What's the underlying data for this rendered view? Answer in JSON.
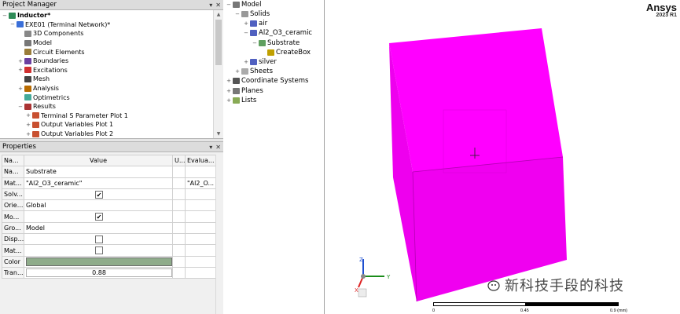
{
  "project_manager": {
    "title": "Project Manager",
    "tree": [
      {
        "label": "Inductor*",
        "level": 0,
        "expander": "−",
        "icon": "project-icon",
        "bold": true
      },
      {
        "label": "EXE01 (Terminal Network)*",
        "level": 1,
        "expander": "−",
        "icon": "design-icon"
      },
      {
        "label": "3D Components",
        "level": 2,
        "expander": "",
        "icon": "components-icon"
      },
      {
        "label": "Model",
        "level": 2,
        "expander": "",
        "icon": "model-icon"
      },
      {
        "label": "Circuit Elements",
        "level": 2,
        "expander": "",
        "icon": "circuit-icon"
      },
      {
        "label": "Boundaries",
        "level": 2,
        "expander": "+",
        "icon": "boundaries-icon"
      },
      {
        "label": "Excitations",
        "level": 2,
        "expander": "+",
        "icon": "excitations-icon"
      },
      {
        "label": "Mesh",
        "level": 2,
        "expander": "",
        "icon": "mesh-icon"
      },
      {
        "label": "Analysis",
        "level": 2,
        "expander": "+",
        "icon": "analysis-icon"
      },
      {
        "label": "Optimetrics",
        "level": 2,
        "expander": "",
        "icon": "optimetrics-icon"
      },
      {
        "label": "Results",
        "level": 2,
        "expander": "−",
        "icon": "results-icon"
      },
      {
        "label": "Terminal S Parameter Plot 1",
        "level": 3,
        "expander": "+",
        "icon": "plot-icon"
      },
      {
        "label": "Output Variables Plot 1",
        "level": 3,
        "expander": "+",
        "icon": "plot-icon"
      },
      {
        "label": "Output Variables Plot 2",
        "level": 3,
        "expander": "+",
        "icon": "plot-icon"
      }
    ]
  },
  "properties": {
    "title": "Properties",
    "columns": {
      "name": "Na...",
      "value": "Value",
      "unit": "U...",
      "evaluated": "Evalua..."
    },
    "rows": [
      {
        "name": "Na...",
        "type": "text",
        "value": "Substrate",
        "evaluated": ""
      },
      {
        "name": "Mat...",
        "type": "text",
        "value": "\"Al2_O3_ceramic\"",
        "evaluated": "\"Al2_O..."
      },
      {
        "name": "Solv...",
        "type": "check",
        "checked": true,
        "evaluated": ""
      },
      {
        "name": "Orie...",
        "type": "text",
        "value": "Global",
        "evaluated": ""
      },
      {
        "name": "Mo...",
        "type": "check",
        "checked": true,
        "evaluated": ""
      },
      {
        "name": "Gro...",
        "type": "text",
        "value": "Model",
        "evaluated": ""
      },
      {
        "name": "Disp...",
        "type": "check",
        "checked": false,
        "evaluated": ""
      },
      {
        "name": "Mat...",
        "type": "check",
        "checked": false,
        "evaluated": ""
      },
      {
        "name": "Color",
        "type": "color",
        "color": "#8fac8b",
        "evaluated": ""
      },
      {
        "name": "Tran...",
        "type": "box",
        "value": "0.88",
        "evaluated": ""
      }
    ]
  },
  "model_tree": [
    {
      "label": "Model",
      "level": 0,
      "expander": "−",
      "icon": "model-icon"
    },
    {
      "label": "Solids",
      "level": 1,
      "expander": "−",
      "icon": "solids-icon"
    },
    {
      "label": "air",
      "level": 2,
      "expander": "+",
      "icon": "material-icon"
    },
    {
      "label": "Al2_O3_ceramic",
      "level": 2,
      "expander": "−",
      "icon": "material-icon"
    },
    {
      "label": "Substrate",
      "level": 3,
      "expander": "−",
      "icon": "object-icon"
    },
    {
      "label": "CreateBox",
      "level": 4,
      "expander": "",
      "icon": "create-box-icon"
    },
    {
      "label": "silver",
      "level": 2,
      "expander": "+",
      "icon": "material-icon"
    },
    {
      "label": "Sheets",
      "level": 1,
      "expander": "+",
      "icon": "sheets-icon"
    },
    {
      "label": "Coordinate Systems",
      "level": 0,
      "expander": "+",
      "icon": "coordinate-systems-icon"
    },
    {
      "label": "Planes",
      "level": 0,
      "expander": "+",
      "icon": "planes-icon"
    },
    {
      "label": "Lists",
      "level": 0,
      "expander": "+",
      "icon": "lists-icon"
    }
  ],
  "viewport": {
    "brand": "Ansys",
    "version": "2023 R1",
    "object_color": "#ff00ff",
    "axes": {
      "x": "X",
      "y": "Y",
      "z": "Z"
    },
    "scale_labels": [
      "0",
      "0.45",
      "0.9 (mm)"
    ],
    "watermark": "新科技手段的科技"
  },
  "colors": {
    "header": "#dcdcdc",
    "panel": "#f0f0f0",
    "substrate": "#8fac8b"
  }
}
